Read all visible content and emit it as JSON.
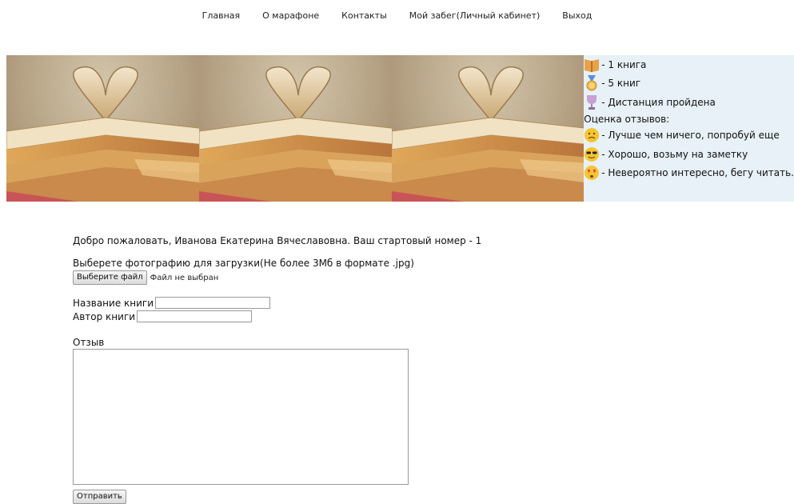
{
  "nav": {
    "items": [
      "Главная",
      "О марафоне",
      "Контакты",
      "Мой забег(Личный кабинет)",
      "Выход"
    ]
  },
  "banner": {
    "images": [
      "books-heart-image",
      "books-heart-image",
      "books-heart-image"
    ]
  },
  "legend": {
    "rows": [
      {
        "icon": "book-icon",
        "text": "- 1 книга"
      },
      {
        "icon": "medal-icon",
        "text": "- 5 книг"
      },
      {
        "icon": "trophy-icon",
        "text": "- Дистанция пройдена"
      }
    ],
    "rating_title": "Оценка отзывов:",
    "ratings": [
      {
        "icon": "sad-face-icon",
        "text": "- Лучше чем ничего, попробуй еще"
      },
      {
        "icon": "cool-face-icon",
        "text": "- Хорошо, возьму на заметку"
      },
      {
        "icon": "love-face-icon",
        "text": "- Невероятно интересно, бегу читать."
      }
    ],
    "colors": {
      "panel_bg": "#e7f1f7",
      "book": "#e8a24a",
      "medal": "#f2b84b",
      "trophy": "#c9a0d6",
      "emoji": "#f7c531"
    }
  },
  "main": {
    "welcome": "Добро пожаловать, Иванова Екатерина Вячеславовна. Ваш стартовый номер - 1",
    "upload_label": "Выберете фотографию для загрузки(Не более 3Мб в формате .jpg)",
    "choose_file_button": "Выберите файл",
    "no_file_text": "Файл не выбран",
    "book_title_label": "Название книги",
    "book_title_value": "",
    "book_author_label": "Автор книги",
    "book_author_value": "",
    "review_label": "Отзыв",
    "review_value": "",
    "submit_button": "Отправить"
  }
}
